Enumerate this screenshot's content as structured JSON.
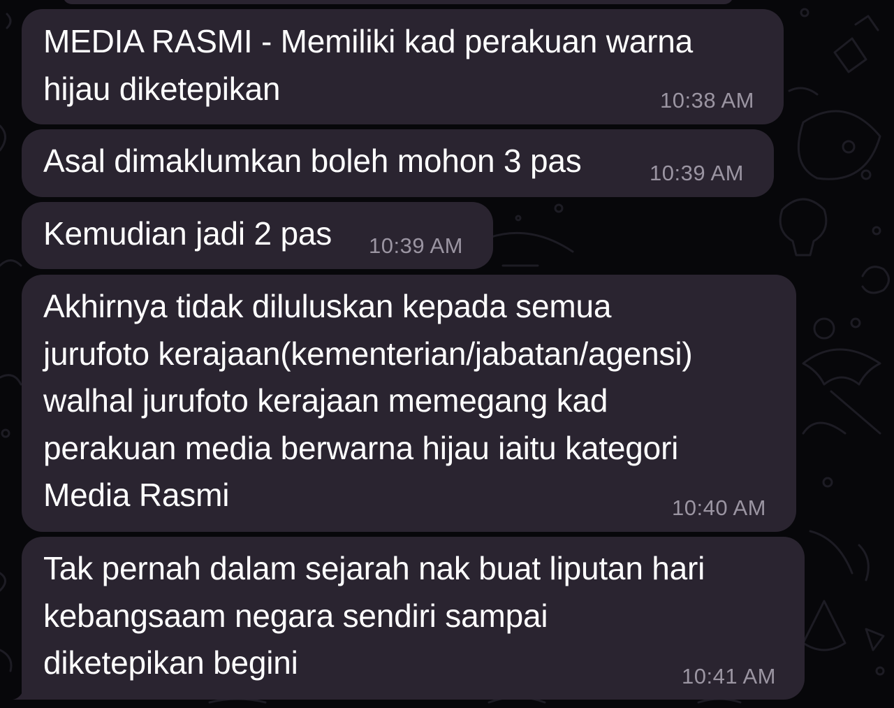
{
  "chat": {
    "messages": [
      {
        "text_lines": [
          "MEDIA RASMI - Memiliki kad perakuan warna",
          "hijau diketepikan"
        ],
        "time": "10:38 AM"
      },
      {
        "text_lines": [
          "Asal dimaklumkan boleh mohon 3 pas"
        ],
        "time": "10:39 AM"
      },
      {
        "text_lines": [
          "Kemudian jadi 2 pas"
        ],
        "time": "10:39 AM"
      },
      {
        "text_lines": [
          "Akhirnya tidak diluluskan kepada semua",
          "jurufoto kerajaan(kementerian/jabatan/agensi)",
          "walhal jurufoto kerajaan memegang kad",
          "perakuan media berwarna hijau iaitu kategori",
          "Media Rasmi"
        ],
        "time": "10:40 AM"
      },
      {
        "text_lines": [
          "Tak pernah dalam sejarah nak buat liputan hari",
          "kebangsaam negara sendiri sampai",
          "diketepikan begini"
        ],
        "time": "10:41 AM"
      }
    ]
  },
  "colors": {
    "background": "#07070a",
    "bubble": "#2a2430",
    "text": "#ffffff",
    "time": "#9b95a2"
  }
}
